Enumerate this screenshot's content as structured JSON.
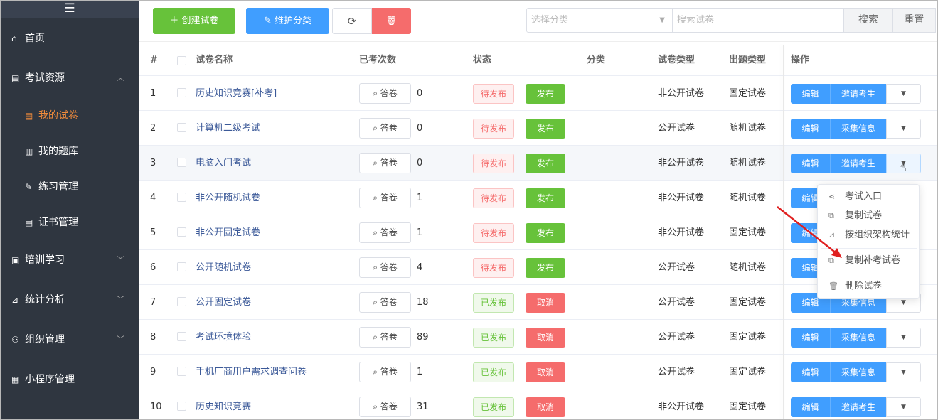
{
  "sidebar": {
    "menu_icon": "☰",
    "items": [
      {
        "icon": "home-icon",
        "glyph": "⌂",
        "label": "首页"
      },
      {
        "icon": "doc-icon",
        "glyph": "▤",
        "label": "考试资源",
        "chev": "︿"
      },
      {
        "icon": "training-icon",
        "glyph": "▣",
        "label": "培训学习",
        "chev": "﹀"
      },
      {
        "icon": "stats-icon",
        "glyph": "⊿",
        "label": "统计分析",
        "chev": "﹀"
      },
      {
        "icon": "org-icon",
        "glyph": "⚇",
        "label": "组织管理",
        "chev": "﹀"
      },
      {
        "icon": "grid-icon",
        "glyph": "▦",
        "label": "小程序管理"
      }
    ],
    "sub_items": [
      {
        "icon": "paper-icon",
        "glyph": "▤",
        "label": "我的试卷",
        "active": true
      },
      {
        "icon": "bank-icon",
        "glyph": "▥",
        "label": "我的题库"
      },
      {
        "icon": "pen-icon",
        "glyph": "✎",
        "label": "练习管理"
      },
      {
        "icon": "cert-icon",
        "glyph": "▤",
        "label": "证书管理"
      }
    ],
    "active_color": "#f08b3b"
  },
  "toolbar": {
    "create_label": "＋ 创建试卷",
    "category_label": "✎ 维护分类",
    "refresh_glyph": "⟳",
    "delete_glyph": "🗑",
    "category_placeholder": "选择分类",
    "search_placeholder": "搜索试卷",
    "search_label": "搜索",
    "reset_label": "重置"
  },
  "table": {
    "headers": {
      "index": "#",
      "name": "试卷名称",
      "count": "已考次数",
      "status": "状态",
      "category": "分类",
      "type": "试卷类型",
      "mode": "出题类型",
      "ops": "操作"
    },
    "answer_label": "答卷",
    "edit_label": "编辑",
    "rows": [
      {
        "idx": "1",
        "name": "历史知识竞赛[补考]",
        "count": "0",
        "status": "待发布",
        "action": "发布",
        "type": "非公开试卷",
        "mode": "固定试卷",
        "op2": "邀请考生"
      },
      {
        "idx": "2",
        "name": "计算机二级考试",
        "count": "0",
        "status": "待发布",
        "action": "发布",
        "type": "公开试卷",
        "mode": "随机试卷",
        "op2": "采集信息"
      },
      {
        "idx": "3",
        "name": "电脑入门考试",
        "count": "0",
        "status": "待发布",
        "action": "发布",
        "type": "非公开试卷",
        "mode": "随机试卷",
        "op2": "邀请考生"
      },
      {
        "idx": "4",
        "name": "非公开随机试卷",
        "count": "1",
        "status": "待发布",
        "action": "发布",
        "type": "非公开试卷",
        "mode": "随机试卷",
        "op2": ""
      },
      {
        "idx": "5",
        "name": "非公开固定试卷",
        "count": "1",
        "status": "待发布",
        "action": "发布",
        "type": "非公开试卷",
        "mode": "固定试卷",
        "op2": ""
      },
      {
        "idx": "6",
        "name": "公开随机试卷",
        "count": "4",
        "status": "待发布",
        "action": "发布",
        "type": "公开试卷",
        "mode": "随机试卷",
        "op2": ""
      },
      {
        "idx": "7",
        "name": "公开固定试卷",
        "count": "18",
        "status": "已发布",
        "action": "取消",
        "type": "公开试卷",
        "mode": "固定试卷",
        "op2": "采集信息"
      },
      {
        "idx": "8",
        "name": "考试环境体验",
        "count": "89",
        "status": "已发布",
        "action": "取消",
        "type": "公开试卷",
        "mode": "固定试卷",
        "op2": "采集信息"
      },
      {
        "idx": "9",
        "name": "手机厂商用户需求调查问卷",
        "count": "1",
        "status": "已发布",
        "action": "取消",
        "type": "公开试卷",
        "mode": "固定试卷",
        "op2": "采集信息"
      },
      {
        "idx": "10",
        "name": "历史知识竞赛",
        "count": "31",
        "status": "已发布",
        "action": "取消",
        "type": "非公开试卷",
        "mode": "固定试卷",
        "op2": "邀请考生"
      }
    ]
  },
  "dropdown": {
    "items": [
      {
        "icon": "share-icon",
        "glyph": "⋖",
        "label": "考试入口"
      },
      {
        "icon": "copy-icon",
        "glyph": "⧉",
        "label": "复制试卷"
      },
      {
        "icon": "chart-icon",
        "glyph": "⊿",
        "label": "按组织架构统计"
      },
      {
        "icon": "copy-icon",
        "glyph": "⧉",
        "label": "复制补考试卷"
      },
      {
        "icon": "trash-icon",
        "glyph": "🗑",
        "label": "删除试卷"
      }
    ]
  },
  "colors": {
    "primary": "#409eff",
    "success": "#67c23a",
    "danger": "#f56c6c",
    "sidebar_bg": "#2f3640",
    "annotation_arrow": "#e02020"
  }
}
